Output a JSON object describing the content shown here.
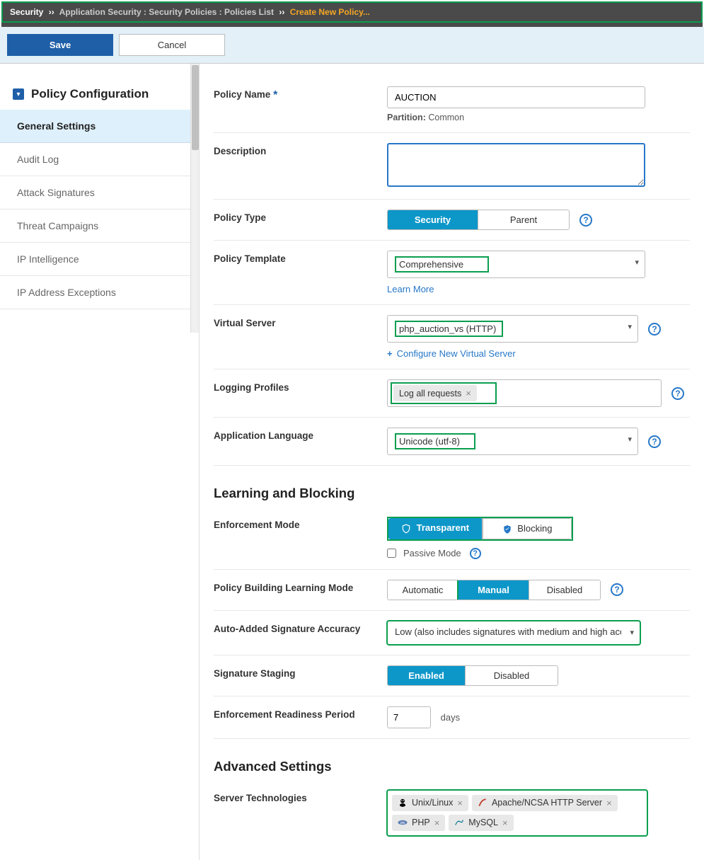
{
  "breadcrumb": {
    "root": "Security",
    "mid": "Application Security : Security Policies : Policies List",
    "current": "Create New Policy...",
    "sep": "››"
  },
  "toolbar": {
    "save": "Save",
    "cancel": "Cancel"
  },
  "sidebar": {
    "title": "Policy Configuration",
    "items": [
      {
        "label": "General Settings",
        "active": true
      },
      {
        "label": "Audit Log"
      },
      {
        "label": "Attack Signatures"
      },
      {
        "label": "Threat Campaigns"
      },
      {
        "label": "IP Intelligence"
      },
      {
        "label": "IP Address Exceptions"
      }
    ]
  },
  "form": {
    "policy_name_label": "Policy Name",
    "policy_name_value": "AUCTION",
    "partition_label": "Partition:",
    "partition_value": "Common",
    "description_label": "Description",
    "policy_type_label": "Policy Type",
    "policy_type_opts": {
      "security": "Security",
      "parent": "Parent"
    },
    "policy_template_label": "Policy Template",
    "policy_template_value": "Comprehensive",
    "learn_more": "Learn More",
    "virtual_server_label": "Virtual Server",
    "virtual_server_value": "php_auction_vs (HTTP)",
    "configure_new_vs": "Configure New Virtual Server",
    "logging_profiles_label": "Logging Profiles",
    "logging_profiles_tag": "Log all requests",
    "app_language_label": "Application Language",
    "app_language_value": "Unicode (utf-8)"
  },
  "learning": {
    "heading": "Learning and Blocking",
    "enforcement_mode_label": "Enforcement Mode",
    "enforcement_opts": {
      "transparent": "Transparent",
      "blocking": "Blocking"
    },
    "passive_mode": "Passive Mode",
    "learning_mode_label": "Policy Building Learning Mode",
    "learning_opts": {
      "automatic": "Automatic",
      "manual": "Manual",
      "disabled": "Disabled"
    },
    "sig_accuracy_label": "Auto-Added Signature Accuracy",
    "sig_accuracy_value": "Low (also includes signatures with medium and high accuracy)",
    "sig_staging_label": "Signature Staging",
    "staging_opts": {
      "enabled": "Enabled",
      "disabled": "Disabled"
    },
    "readiness_label": "Enforcement Readiness Period",
    "readiness_value": "7",
    "readiness_unit": "days"
  },
  "advanced": {
    "heading": "Advanced Settings",
    "server_tech_label": "Server Technologies",
    "tags": [
      "Unix/Linux",
      "Apache/NCSA HTTP Server",
      "PHP",
      "MySQL"
    ]
  },
  "colors": {
    "accent": "#1f5fa8",
    "teal": "#0d97c9",
    "highlight": "#0a9e4f",
    "link": "#2678c8"
  }
}
